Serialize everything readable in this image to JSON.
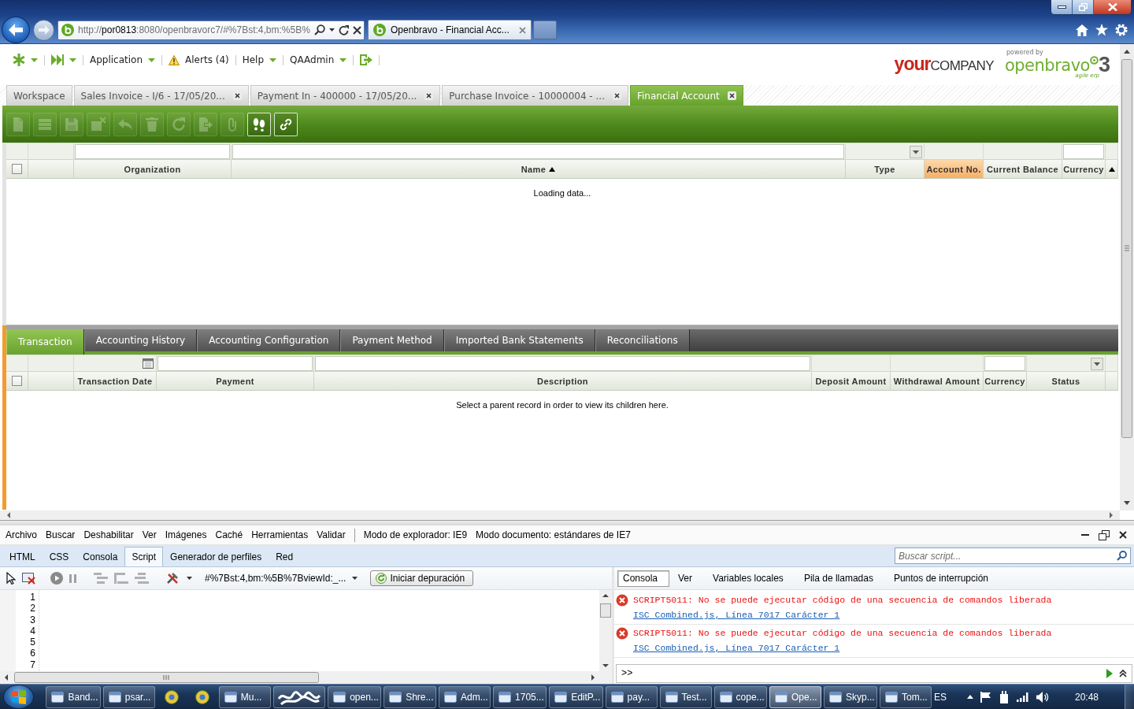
{
  "browser": {
    "address": {
      "scheme": "http://",
      "host": "por0813",
      "path": ":8080/openbravorc7/#%7Bst:4,bm:%5B%"
    },
    "tabs": [
      {
        "title": "Openbravo - Financial Acc...",
        "selected": true
      }
    ]
  },
  "app": {
    "menu": [
      {
        "kind": "dropdown",
        "label": "Application"
      },
      {
        "kind": "alerts",
        "label": "Alerts (4)"
      },
      {
        "kind": "dropdown",
        "label": "Help"
      },
      {
        "kind": "dropdown",
        "label": "QAAdmin"
      }
    ],
    "company_logo": {
      "accent": "your",
      "rest": "COMPANY"
    },
    "vendor_logo": {
      "caption": "powered by",
      "name": "openbravo",
      "version": "3",
      "tagline": "agile erp"
    },
    "window_tabs": [
      {
        "label": "Workspace",
        "closable": false,
        "selected": false
      },
      {
        "label": "Sales Invoice - I/6 - 17/05/20...",
        "closable": true,
        "selected": false
      },
      {
        "label": "Payment In - 400000 - 17/05/20...",
        "closable": true,
        "selected": false
      },
      {
        "label": "Purchase Invoice - 10000004 - ...",
        "closable": true,
        "selected": false
      },
      {
        "label": "Financial Account",
        "closable": true,
        "selected": true
      }
    ],
    "toolbar": [
      {
        "kind": "new",
        "disabled": true
      },
      {
        "kind": "form",
        "disabled": true
      },
      {
        "kind": "save",
        "disabled": true
      },
      {
        "kind": "erase",
        "disabled": true
      },
      {
        "kind": "undo",
        "disabled": true
      },
      {
        "kind": "delete",
        "disabled": true
      },
      {
        "kind": "refresh",
        "disabled": true
      },
      {
        "kind": "export",
        "disabled": true
      },
      {
        "kind": "attach",
        "disabled": true
      },
      {
        "kind": "audit",
        "disabled": false
      },
      {
        "kind": "link",
        "disabled": false
      }
    ],
    "parent_grid": {
      "focused": false,
      "all_checked": false,
      "columns": [
        {
          "label": "Organization",
          "filter": {
            "kind": "text"
          },
          "sorted": false,
          "highlighted": false
        },
        {
          "label": "Name",
          "filter": {
            "kind": "text"
          },
          "sorted": true,
          "highlighted": false
        },
        {
          "label": "Type",
          "filter": {
            "kind": "select"
          },
          "sorted": false,
          "highlighted": false
        },
        {
          "label": "Account No.",
          "sorted": false,
          "highlighted": true
        },
        {
          "label": "Current Balance",
          "sorted": false,
          "highlighted": false
        },
        {
          "label": "Currency",
          "filter": {
            "kind": "text"
          },
          "sorted": false,
          "highlighted": false
        }
      ],
      "message": "Loading data..."
    },
    "child_tabs": [
      {
        "label": "Transaction",
        "selected": true
      },
      {
        "label": "Accounting History",
        "selected": false
      },
      {
        "label": "Accounting Configuration",
        "selected": false
      },
      {
        "label": "Payment Method",
        "selected": false
      },
      {
        "label": "Imported Bank Statements",
        "selected": false
      },
      {
        "label": "Reconciliations",
        "selected": false
      }
    ],
    "child_grid": {
      "focused": true,
      "all_checked": false,
      "columns": [
        {
          "label": "Transaction Date",
          "filter": {
            "kind": "date"
          },
          "sorted": false,
          "highlighted": false
        },
        {
          "label": "Payment",
          "filter": {
            "kind": "text"
          },
          "sorted": false,
          "highlighted": false
        },
        {
          "label": "Description",
          "filter": {
            "kind": "text"
          },
          "sorted": false,
          "highlighted": false
        },
        {
          "label": "Deposit Amount",
          "sorted": false,
          "highlighted": false
        },
        {
          "label": "Withdrawal Amount",
          "sorted": false,
          "highlighted": false
        },
        {
          "label": "Currency",
          "filter": {
            "kind": "text"
          },
          "sorted": false,
          "highlighted": false
        },
        {
          "label": "Status",
          "filter": {
            "kind": "select"
          },
          "sorted": false,
          "highlighted": false
        }
      ],
      "message": "Select a parent record in order to view its children here."
    }
  },
  "devtools": {
    "menu": [
      "Archivo",
      "Buscar",
      "Deshabilitar",
      "Ver",
      "Imágenes",
      "Caché",
      "Herramientas",
      "Validar"
    ],
    "modes": [
      "Modo de explorador: IE9",
      "Modo documento: estándares de IE7"
    ],
    "tabs": [
      {
        "label": "HTML",
        "selected": false
      },
      {
        "label": "CSS",
        "selected": false
      },
      {
        "label": "Consola",
        "selected": false
      },
      {
        "label": "Script",
        "selected": true
      },
      {
        "label": "Generador de perfiles",
        "selected": false
      },
      {
        "label": "Red",
        "selected": false
      }
    ],
    "search": {
      "placeholder": "Buscar script..."
    },
    "script_selector": "#%7Bst:4,bm:%5B%7BviewId:_...",
    "debug_button": "Iniciar depuración",
    "line_numbers": [
      "1",
      "2",
      "3",
      "4",
      "5",
      "6",
      "7"
    ],
    "console_tabs": [
      {
        "label": "Consola",
        "selected": true
      },
      {
        "label": "Ver",
        "selected": false
      },
      {
        "label": "Variables locales",
        "selected": false
      },
      {
        "label": "Pila de llamadas",
        "selected": false
      },
      {
        "label": "Puntos de interrupción",
        "selected": false
      }
    ],
    "messages": [
      {
        "kind": "error",
        "text": "SCRIPT5011: No se puede ejecutar código de una secuencia de comandos liberada",
        "source": "ISC Combined.js, Línea 7017 Carácter 1"
      },
      {
        "kind": "error",
        "text": "SCRIPT5011: No se puede ejecutar código de una secuencia de comandos liberada",
        "source": "ISC Combined.js, Línea 7017 Carácter 1"
      }
    ],
    "prompt": ">>"
  },
  "taskbar": {
    "items": [
      {
        "kind": "window",
        "label": "Band...",
        "selected": false
      },
      {
        "kind": "window",
        "label": "psar...",
        "selected": false
      },
      {
        "kind": "pinned",
        "selected": false
      },
      {
        "kind": "pinned",
        "selected": false
      },
      {
        "kind": "window",
        "label": "Mu...",
        "selected": false
      },
      {
        "kind": "redacted",
        "selected": false
      },
      {
        "kind": "window",
        "label": "open...",
        "selected": false
      },
      {
        "kind": "window",
        "label": "Shre...",
        "selected": false
      },
      {
        "kind": "window",
        "label": "Adm...",
        "selected": false
      },
      {
        "kind": "window",
        "label": "1705...",
        "selected": false
      },
      {
        "kind": "window",
        "label": "EditP...",
        "selected": false
      },
      {
        "kind": "window",
        "label": "pay...",
        "selected": false
      },
      {
        "kind": "window",
        "label": "Test...",
        "selected": false
      },
      {
        "kind": "window",
        "label": "cope...",
        "selected": false
      },
      {
        "kind": "window",
        "label": "Ope...",
        "selected": true
      },
      {
        "kind": "window",
        "label": "Skyp...",
        "selected": false
      },
      {
        "kind": "window",
        "label": "Tom...",
        "selected": false
      }
    ],
    "language": "ES",
    "clock": "20:48"
  }
}
